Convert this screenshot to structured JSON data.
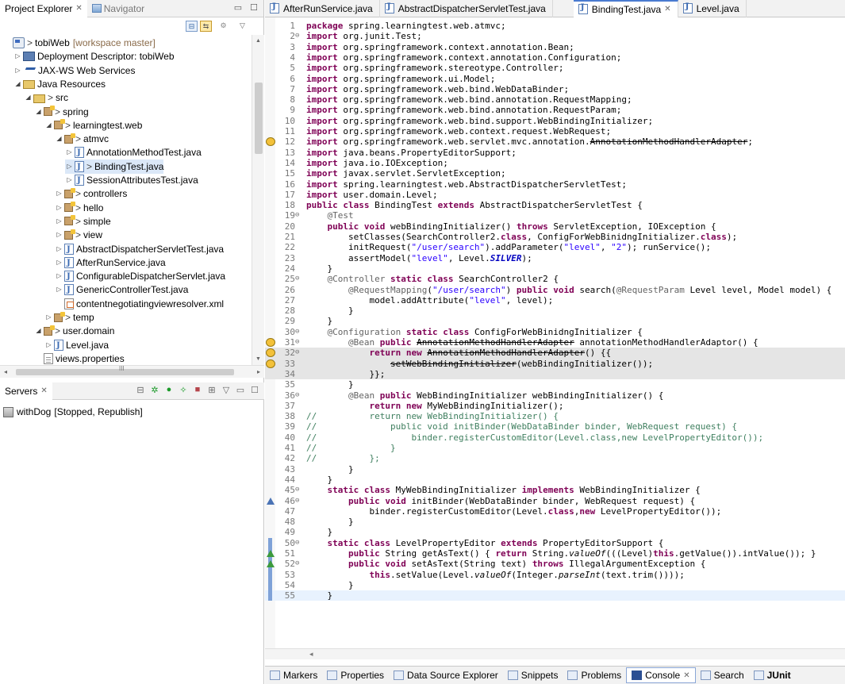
{
  "left_views": {
    "tabs": [
      {
        "label": "Project Explorer",
        "close": "✕",
        "active": true
      },
      {
        "label": "Navigator",
        "active": false
      }
    ],
    "controls": [
      "minimize",
      "maximize",
      "menu"
    ]
  },
  "tree": [
    {
      "label": "tobiWeb",
      "suffix": "[workspace master]",
      "indent": 0,
      "twisty": "",
      "icon": "project",
      "gt": true
    },
    {
      "label": "Deployment Descriptor: tobiWeb",
      "indent": 1,
      "twisty": "▷",
      "icon": "dd"
    },
    {
      "label": "JAX-WS Web Services",
      "indent": 1,
      "twisty": "▷",
      "icon": "ws"
    },
    {
      "label": "Java Resources",
      "indent": 1,
      "twisty": "◢",
      "icon": "folder"
    },
    {
      "label": "src",
      "indent": 2,
      "twisty": "◢",
      "icon": "folder",
      "gt": true
    },
    {
      "label": "spring",
      "indent": 3,
      "twisty": "◢",
      "icon": "package",
      "gt": true
    },
    {
      "label": "learningtest.web",
      "indent": 4,
      "twisty": "◢",
      "icon": "package",
      "gt": true
    },
    {
      "label": "atmvc",
      "indent": 5,
      "twisty": "◢",
      "icon": "package",
      "gt": true
    },
    {
      "label": "AnnotationMethodTest.java",
      "indent": 6,
      "twisty": "▷",
      "icon": "java"
    },
    {
      "label": "BindingTest.java",
      "indent": 6,
      "twisty": "▷",
      "icon": "java",
      "gt": true
    },
    {
      "label": "SessionAttributesTest.java",
      "indent": 6,
      "twisty": "▷",
      "icon": "java"
    },
    {
      "label": "controllers",
      "indent": 5,
      "twisty": "▷",
      "icon": "package",
      "gt": true
    },
    {
      "label": "hello",
      "indent": 5,
      "twisty": "▷",
      "icon": "package",
      "gt": true
    },
    {
      "label": "simple",
      "indent": 5,
      "twisty": "▷",
      "icon": "package",
      "gt": true
    },
    {
      "label": "view",
      "indent": 5,
      "twisty": "▷",
      "icon": "package",
      "gt": true
    },
    {
      "label": "AbstractDispatcherServletTest.java",
      "indent": 5,
      "twisty": "▷",
      "icon": "java"
    },
    {
      "label": "AfterRunService.java",
      "indent": 5,
      "twisty": "▷",
      "icon": "java"
    },
    {
      "label": "ConfigurableDispatcherServlet.java",
      "indent": 5,
      "twisty": "▷",
      "icon": "java"
    },
    {
      "label": "GenericControllerTest.java",
      "indent": 5,
      "twisty": "▷",
      "icon": "java"
    },
    {
      "label": "contentnegotiatingviewresolver.xml",
      "indent": 5,
      "twisty": "",
      "icon": "xml"
    },
    {
      "label": "temp",
      "indent": 4,
      "twisty": "▷",
      "icon": "package",
      "gt": true
    },
    {
      "label": "user.domain",
      "indent": 3,
      "twisty": "◢",
      "icon": "package",
      "gt": true
    },
    {
      "label": "Level.java",
      "indent": 4,
      "twisty": "▷",
      "icon": "java"
    },
    {
      "label": "views.properties",
      "indent": 3,
      "twisty": "",
      "icon": "file"
    }
  ],
  "tree_scroll": {
    "h_thumb_label": "III"
  },
  "servers": {
    "tab": "Servers",
    "close": "✕",
    "item": "withDog",
    "status": "[Stopped, Republish]"
  },
  "editor_tabs": [
    {
      "label": "AfterRunService.java",
      "active": false
    },
    {
      "label": "AbstractDispatcherServletTest.java",
      "active": false
    },
    {
      "label": "BindingTest.java",
      "active": true,
      "close": "✕"
    },
    {
      "label": "Level.java",
      "active": false
    }
  ],
  "code_lines": [
    {
      "n": "1",
      "t": "package spring.learningtest.web.atmvc;"
    },
    {
      "n": "2",
      "f": "⊖",
      "t": "import org.junit.Test;"
    },
    {
      "n": "3",
      "t": "import org.springframework.context.annotation.Bean;"
    },
    {
      "n": "4",
      "t": "import org.springframework.context.annotation.Configuration;"
    },
    {
      "n": "5",
      "t": "import org.springframework.stereotype.Controller;"
    },
    {
      "n": "6",
      "t": "import org.springframework.ui.Model;"
    },
    {
      "n": "7",
      "t": "import org.springframework.web.bind.WebDataBinder;"
    },
    {
      "n": "8",
      "t": "import org.springframework.web.bind.annotation.RequestMapping;"
    },
    {
      "n": "9",
      "t": "import org.springframework.web.bind.annotation.RequestParam;"
    },
    {
      "n": "10",
      "t": "import org.springframework.web.bind.support.WebBindingInitializer;"
    },
    {
      "n": "11",
      "t": "import org.springframework.web.context.request.WebRequest;"
    },
    {
      "n": "12",
      "m": "warn",
      "t": "import org.springframework.web.servlet.mvc.annotation.AnnotationMethodHandlerAdapter;"
    },
    {
      "n": "13",
      "t": "import java.beans.PropertyEditorSupport;"
    },
    {
      "n": "14",
      "t": "import java.io.IOException;"
    },
    {
      "n": "15",
      "t": "import javax.servlet.ServletException;"
    },
    {
      "n": "16",
      "t": "import spring.learningtest.web.AbstractDispatcherServletTest;"
    },
    {
      "n": "17",
      "t": "import user.domain.Level;"
    },
    {
      "n": "18",
      "t": "public class BindingTest extends AbstractDispatcherServletTest {"
    },
    {
      "n": "19",
      "f": "⊖",
      "t": "    @Test"
    },
    {
      "n": "20",
      "t": "    public void webBindingInitializer() throws ServletException, IOException {"
    },
    {
      "n": "21",
      "t": "        setClasses(SearchController2.class, ConfigForWebBinidngInitializer.class);"
    },
    {
      "n": "22",
      "t": "        initRequest(\"/user/search\").addParameter(\"level\", \"2\"); runService();"
    },
    {
      "n": "23",
      "t": "        assertModel(\"level\", Level.SILVER);"
    },
    {
      "n": "24",
      "t": "    }"
    },
    {
      "n": "25",
      "f": "⊖",
      "t": "    @Controller static class SearchController2 {"
    },
    {
      "n": "26",
      "t": "        @RequestMapping(\"/user/search\") public void search(@RequestParam Level level, Model model) {"
    },
    {
      "n": "27",
      "t": "            model.addAttribute(\"level\", level);"
    },
    {
      "n": "28",
      "t": "        }"
    },
    {
      "n": "29",
      "t": "    }"
    },
    {
      "n": "30",
      "f": "⊖",
      "t": "    @Configuration static class ConfigForWebBinidngInitializer {"
    },
    {
      "n": "31",
      "f": "⊖",
      "m": "warn",
      "t": "        @Bean public AnnotationMethodHandlerAdapter annotationMethodHandlerAdaptor() {"
    },
    {
      "n": "32",
      "f": "⊖",
      "m": "warn",
      "hl": true,
      "t": "            return new AnnotationMethodHandlerAdapter() {{"
    },
    {
      "n": "33",
      "m": "warn",
      "hl": true,
      "t": "                setWebBindingInitializer(webBindingInitializer());"
    },
    {
      "n": "34",
      "hl": true,
      "t": "            }};"
    },
    {
      "n": "35",
      "t": "        }"
    },
    {
      "n": "36",
      "f": "⊖",
      "t": "        @Bean public WebBindingInitializer webBindingInitializer() {"
    },
    {
      "n": "37",
      "t": "            return new MyWebBindingInitializer();"
    },
    {
      "n": "38",
      "t": "//          return new WebBindingInitializer() {"
    },
    {
      "n": "39",
      "t": "//              public void initBinder(WebDataBinder binder, WebRequest request) {"
    },
    {
      "n": "40",
      "t": "//                  binder.registerCustomEditor(Level.class,new LevelPropertyEditor());"
    },
    {
      "n": "41",
      "t": "//              }"
    },
    {
      "n": "42",
      "t": "//          };"
    },
    {
      "n": "43",
      "t": "        }"
    },
    {
      "n": "44",
      "t": "    }"
    },
    {
      "n": "45",
      "f": "⊖",
      "t": "    static class MyWebBindingInitializer implements WebBindingInitializer {"
    },
    {
      "n": "46",
      "f": "⊖",
      "m": "impl",
      "t": "        public void initBinder(WebDataBinder binder, WebRequest request) {"
    },
    {
      "n": "47",
      "t": "            binder.registerCustomEditor(Level.class,new LevelPropertyEditor());"
    },
    {
      "n": "48",
      "t": "        }"
    },
    {
      "n": "49",
      "t": "    }"
    },
    {
      "n": "50",
      "f": "⊖",
      "sel": true,
      "t": "    static class LevelPropertyEditor extends PropertyEditorSupport {"
    },
    {
      "n": "51",
      "m": "ovr",
      "sel": true,
      "t": "        public String getAsText() { return String.valueOf(((Level)this.getValue()).intValue()); }"
    },
    {
      "n": "52",
      "f": "⊖",
      "m": "ovr",
      "sel": true,
      "t": "        public void setAsText(String text) throws IllegalArgumentException {"
    },
    {
      "n": "53",
      "sel": true,
      "t": "            this.setValue(Level.valueOf(Integer.parseInt(text.trim())));"
    },
    {
      "n": "54",
      "sel": true,
      "t": "        }"
    },
    {
      "n": "55",
      "sel": true,
      "cur": true,
      "t": "    }"
    }
  ],
  "bottom_tabs": [
    {
      "label": "Markers",
      "icon": "markers-icon"
    },
    {
      "label": "Properties",
      "icon": "properties-icon"
    },
    {
      "label": "Data Source Explorer",
      "icon": "data-source-icon"
    },
    {
      "label": "Snippets",
      "icon": "snippets-icon"
    },
    {
      "label": "Problems",
      "icon": "problems-icon"
    },
    {
      "label": "Console",
      "icon": "console-icon",
      "active": true,
      "close": "✕"
    },
    {
      "label": "Search",
      "icon": "search-icon"
    },
    {
      "label": "JUnit",
      "icon": "junit-icon",
      "bold": true
    }
  ],
  "colors": {
    "keyword": "#7f0055",
    "string": "#2a00ff",
    "annotation": "#646464",
    "comment": "#3f7f5f",
    "static_field": "#0000c0",
    "highlight_line": "#e5e5e5",
    "current_line": "#e8f2fe"
  }
}
